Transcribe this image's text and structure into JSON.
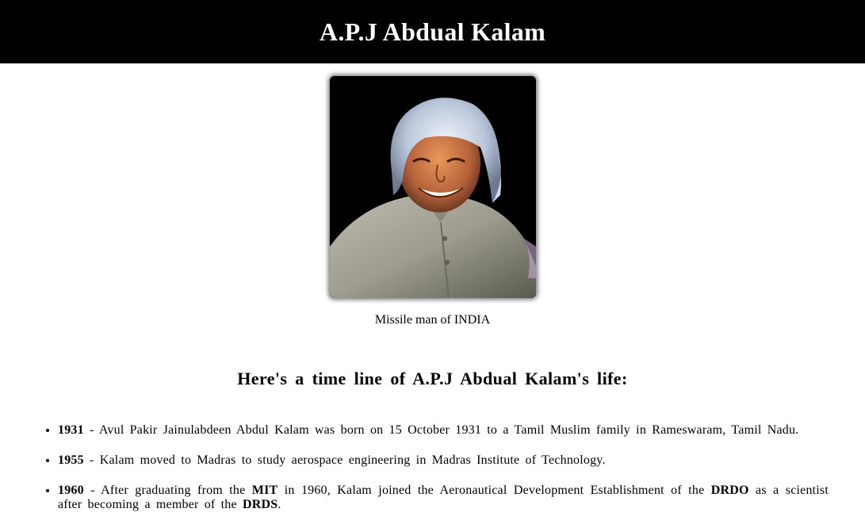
{
  "header": {
    "title": "A.P.J Abdual Kalam"
  },
  "portrait": {
    "caption": "Missile man of INDIA"
  },
  "timeline": {
    "heading": "Here's a time line of A.P.J Abdual Kalam's life:",
    "items": [
      {
        "year": "1931",
        "text": " - Avul Pakir Jainulabdeen Abdul Kalam was born on 15 October 1931 to a Tamil Muslim family in Rameswaram, Tamil Nadu."
      },
      {
        "year": "1955",
        "text": " - Kalam moved to Madras to study aerospace engineering in Madras Institute of Technology."
      },
      {
        "year": "1960",
        "text_a": " - After graduating from the ",
        "bold_a": "MIT",
        "text_b": " in 1960, Kalam joined the Aeronautical Development Establishment of the ",
        "bold_b": "DRDO",
        "text_c": " as a scientist after becoming a member of the ",
        "bold_c": "DRDS",
        "text_d": "."
      }
    ]
  },
  "colors": {
    "header_bg": "#000000",
    "header_text": "#ffffff",
    "page_bg": "#ffffff"
  }
}
